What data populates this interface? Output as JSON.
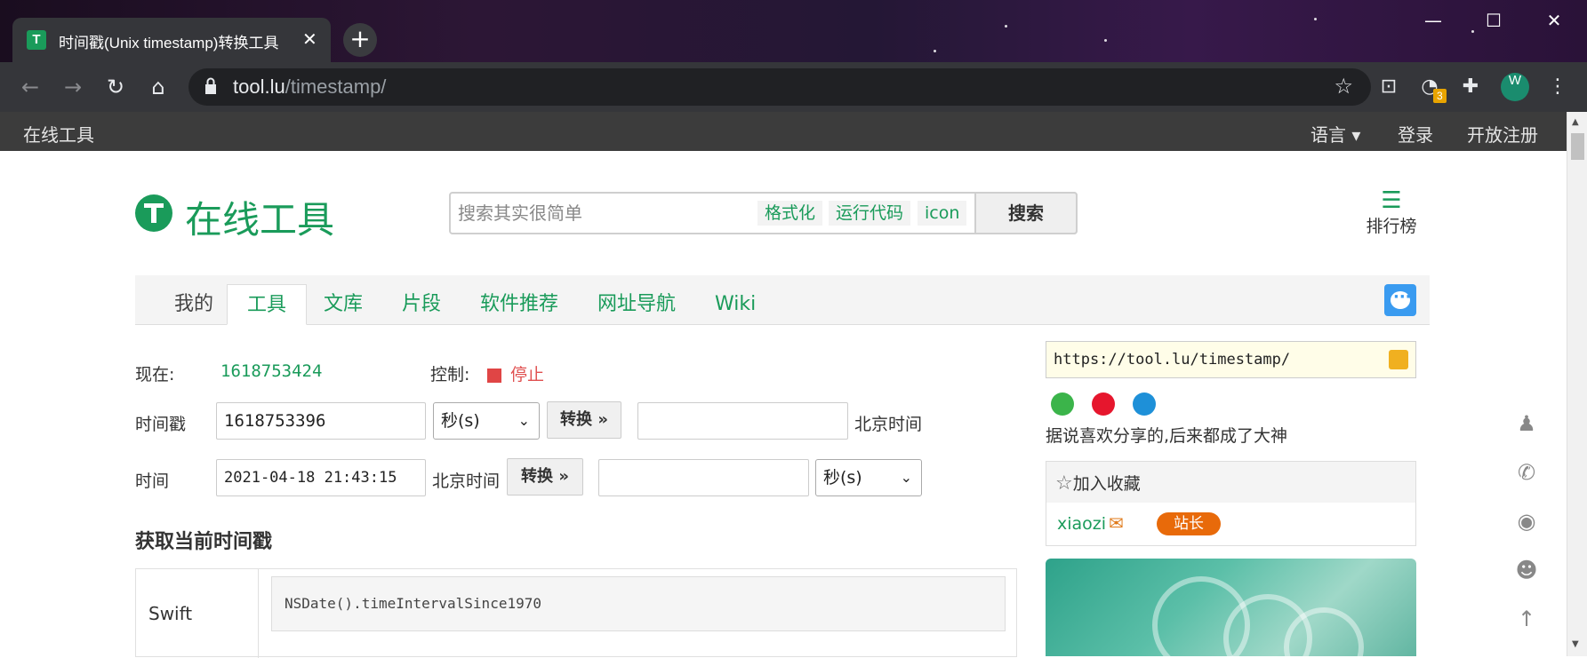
{
  "browser": {
    "tab_title": "时间戳(Unix timestamp)转换工具",
    "tab_favicon": "T",
    "url_domain": "tool.lu",
    "url_path": "/timestamp/",
    "extension_badge": "3",
    "avatar_letter": "W"
  },
  "sitebar": {
    "brand": "在线工具",
    "language": "语言",
    "login": "登录",
    "register": "开放注册"
  },
  "header": {
    "logo_text": "在线工具",
    "search_placeholder": "搜索其实很简单",
    "quick_tags": [
      "格式化",
      "运行代码",
      "icon"
    ],
    "search_button": "搜索",
    "rank_label": "排行榜"
  },
  "nav": {
    "tabs": [
      "我的",
      "工具",
      "文库",
      "片段",
      "软件推荐",
      "网址导航",
      "Wiki"
    ],
    "active": "工具"
  },
  "tool": {
    "now_label": "现在:",
    "now_value": "1618753424",
    "control_label": "控制:",
    "control_value": "停止",
    "ts_label": "时间戳",
    "ts_value": "1618753396",
    "ts_unit": "秒(s)",
    "convert": "转换",
    "ts_result_label": "北京时间",
    "time_label": "时间",
    "time_value": "2021-04-18 21:43:15",
    "time_zone_label": "北京时间",
    "time_unit": "秒(s)",
    "section_title": "获取当前时间戳",
    "code_rows": [
      {
        "lang": "Swift",
        "code": "NSDate().timeIntervalSince1970"
      }
    ]
  },
  "sidebar": {
    "share_url": "https://tool.lu/timestamp/",
    "share_text": "据说喜欢分享的,后来都成了大神",
    "fav_title": "加入收藏",
    "user": "xiaozi",
    "user_badge": "站长"
  },
  "colors": {
    "brand_green": "#1a9b5a",
    "stop_red": "#e04545",
    "badge_orange": "#e86a0a",
    "chat_blue": "#3a9bf0"
  }
}
